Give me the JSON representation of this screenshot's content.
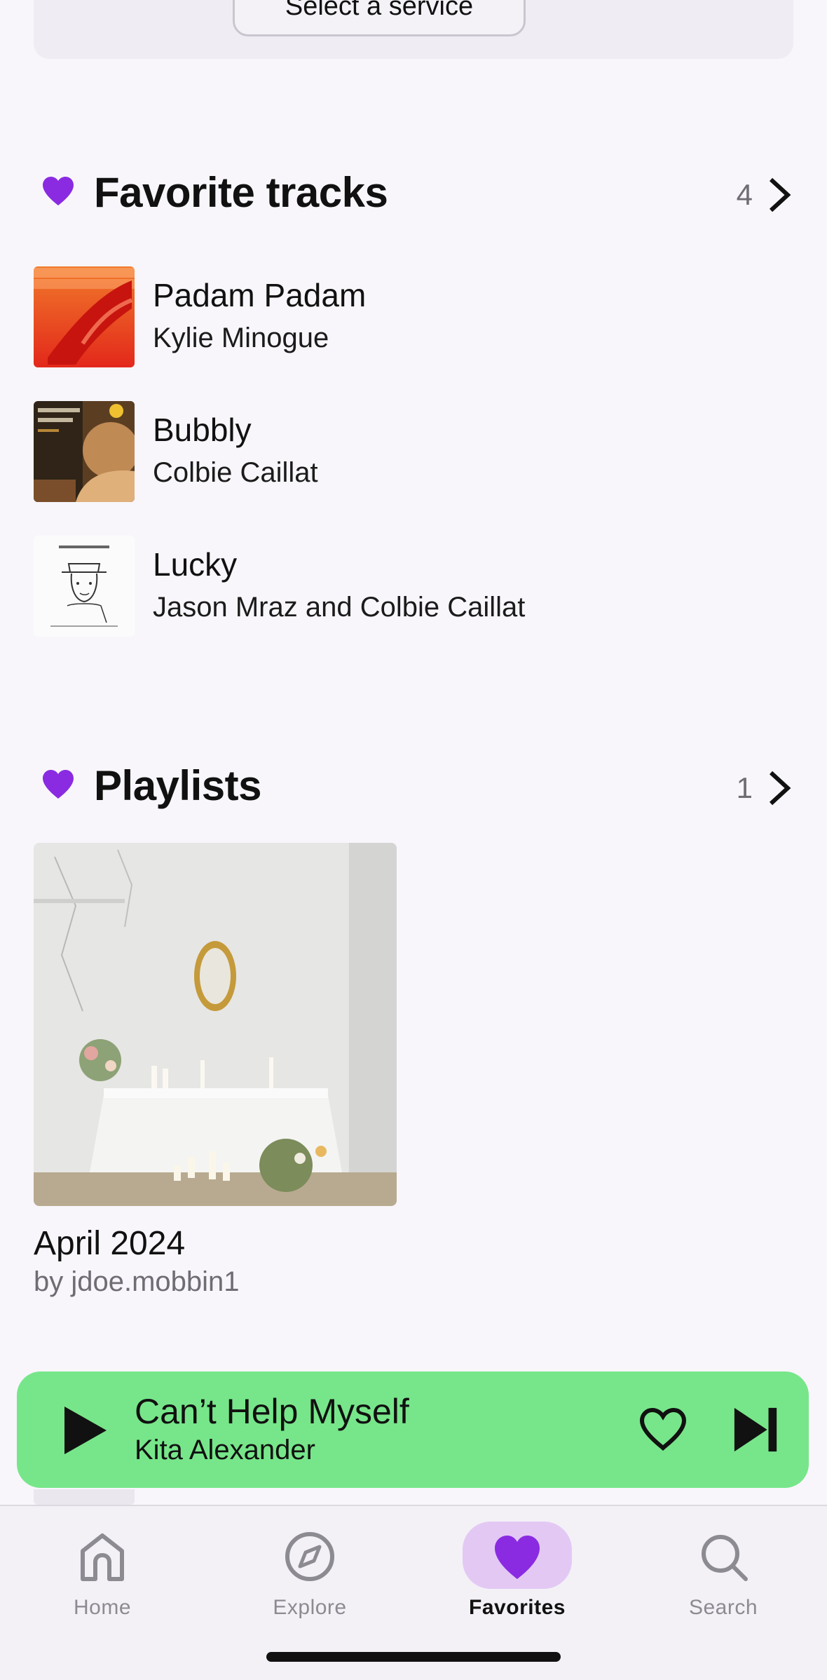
{
  "service": {
    "button_label": "Select a service"
  },
  "favorite_tracks": {
    "title": "Favorite tracks",
    "count": "4",
    "items": [
      {
        "name": "Padam Padam",
        "artist": "Kylie Minogue"
      },
      {
        "name": "Bubbly",
        "artist": "Colbie Caillat"
      },
      {
        "name": "Lucky",
        "artist": "Jason Mraz and Colbie Caillat"
      }
    ]
  },
  "playlists": {
    "title": "Playlists",
    "count": "1",
    "items": [
      {
        "name": "April 2024",
        "owner": "by jdoe.mobbin1"
      }
    ]
  },
  "now_playing": {
    "title": "Can’t Help Myself",
    "artist": "Kita Alexander"
  },
  "tabs": [
    {
      "label": "Home",
      "icon": "home-icon"
    },
    {
      "label": "Explore",
      "icon": "compass-icon"
    },
    {
      "label": "Favorites",
      "icon": "heart-icon",
      "active": true
    },
    {
      "label": "Search",
      "icon": "search-icon"
    }
  ],
  "colors": {
    "accent_purple": "#8a2be2",
    "now_playing_green": "#77e68a",
    "active_tab_pill": "#e3c8f4"
  }
}
